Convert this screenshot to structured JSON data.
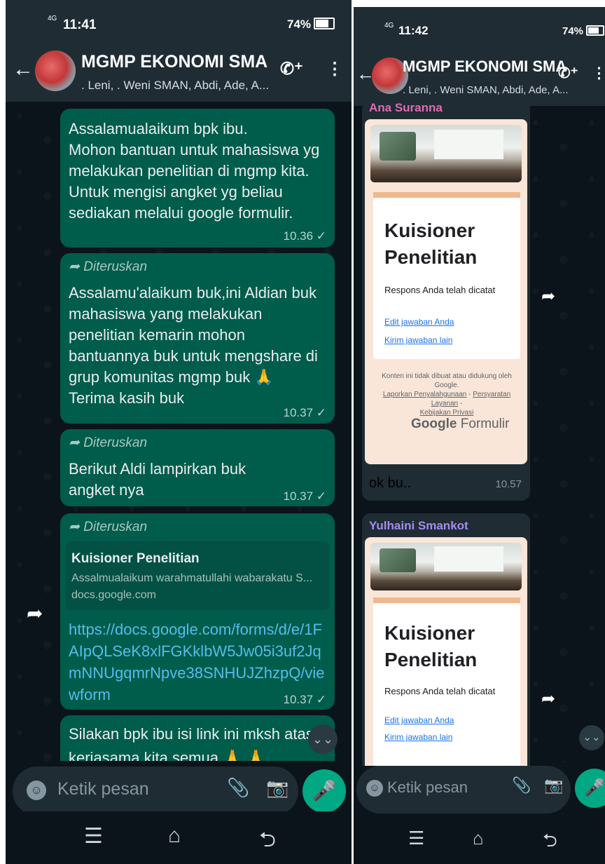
{
  "left": {
    "status": {
      "network": "4G",
      "time": "11:41",
      "battery": "74%"
    },
    "header": {
      "title": "MGMP EKONOMI SMA",
      "subtitle": ". Leni, . Weni SMAN, Abdi, Ade, A..."
    },
    "messages": [
      {
        "text": "Assalamualaikum bpk ibu.\nMohon bantuan untuk mahasiswa yg melakukan penelitian di mgmp kita. Untuk mengisi angket yg beliau sediakan melalui google formulir.",
        "time": "10.36 ✓"
      },
      {
        "forwarded": "Diteruskan",
        "text": "Assalamu'alaikum buk,ini Aldian buk mahasiswa yang melakukan penelitian kemarin mohon bantuannya buk untuk mengshare di grup komunitas mgmp buk 🙏\nTerima kasih buk",
        "time": "10.37 ✓"
      },
      {
        "forwarded": "Diteruskan",
        "text": "Berikut Aldi lampirkan buk angket nya",
        "time": "10.37 ✓"
      },
      {
        "forwarded": "Diteruskan",
        "link_title": "Kuisioner Penelitian",
        "link_desc": "Assalmualaikum warahmatullahi wabarakatu S...",
        "link_domain": "docs.google.com",
        "url": "https://docs.google.com/forms/d/e/1FAIpQLSeK8xlFGKklbW5Jw05i3uf2JqmNNUgqmrNpve38SNHUJZhzpQ/viewform",
        "time": "10.37 ✓"
      },
      {
        "text": "Silakan bpk ibu isi link ini  mksh atas kerjasama kita semua 🙏 🙏"
      }
    ],
    "input_placeholder": "Ketik pesan"
  },
  "right": {
    "status": {
      "network": "4G",
      "time": "11:42",
      "battery": "74%"
    },
    "header": {
      "title": "MGMP EKONOMI SMA",
      "subtitle": ". Leni, . Weni SMAN, Abdi, Ade, A..."
    },
    "msg1": {
      "sender_partial": "Ana Suranna",
      "form": {
        "title_line1": "Kuisioner",
        "title_line2": "Penelitian",
        "response": "Respons Anda telah dicatat",
        "edit": "Edit jawaban Anda",
        "resubmit": "Kirim jawaban lain",
        "disclaimer": "Konten ini tidak dibuat atau didukung oleh Google.",
        "report": "Laporkan Penyalahgunaan",
        "terms": "Persyaratan Layanan",
        "privacy": "Kebijakan Privasi",
        "brand_google": "Google",
        "brand_formulir": "Formulir"
      },
      "caption": "ok bu..",
      "time": "10.57"
    },
    "msg2": {
      "sender": "Yulhaini Smankot",
      "form": {
        "title_line1": "Kuisioner",
        "title_line2": "Penelitian",
        "response": "Respons Anda telah dicatat",
        "edit": "Edit jawaban Anda",
        "resubmit": "Kirim jawaban lain"
      }
    },
    "input_placeholder": "Ketik pesan"
  },
  "colors": {
    "sent_bubble": "#005c4b",
    "received_bubble": "#1f2c34",
    "accent": "#00a884",
    "link": "#53bdeb",
    "sender1": "#e26ab0",
    "sender2": "#a48cf0"
  }
}
